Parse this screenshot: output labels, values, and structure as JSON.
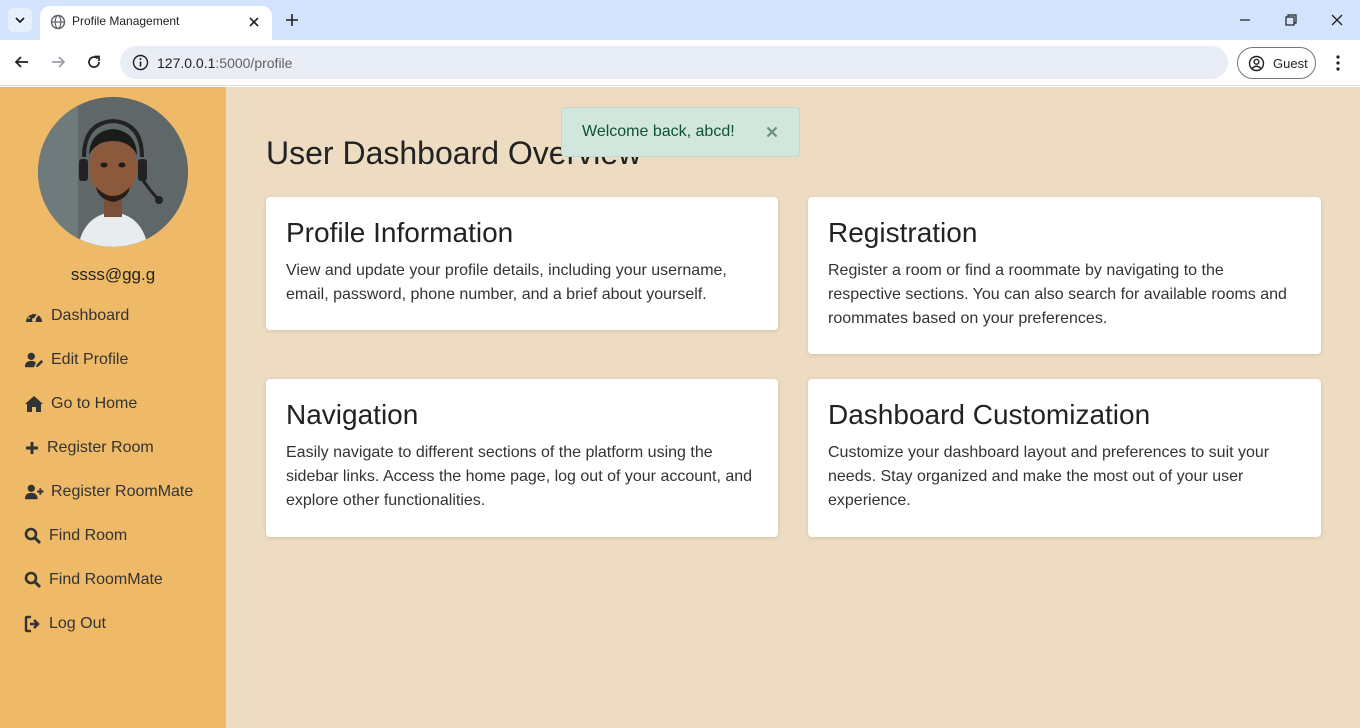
{
  "browser": {
    "tab_title": "Profile Management",
    "url_host": "127.0.0.1",
    "url_rest": ":5000/profile",
    "profile_label": "Guest"
  },
  "sidebar": {
    "email": "ssss@gg.g",
    "items": [
      {
        "label": "Dashboard",
        "icon": "tachometer-icon"
      },
      {
        "label": "Edit Profile",
        "icon": "user-edit-icon"
      },
      {
        "label": "Go to Home",
        "icon": "home-icon"
      },
      {
        "label": "Register Room",
        "icon": "plus-icon"
      },
      {
        "label": "Register RoomMate",
        "icon": "user-plus-icon"
      },
      {
        "label": "Find Room",
        "icon": "search-icon"
      },
      {
        "label": "Find RoomMate",
        "icon": "search-icon"
      },
      {
        "label": "Log Out",
        "icon": "sign-out-icon"
      }
    ]
  },
  "main": {
    "title": "User Dashboard Overview",
    "toast": {
      "message": "Welcome back, abcd!"
    },
    "cards": [
      {
        "title": "Profile Information",
        "text": "View and update your profile details, including your username, email, password, phone number, and a brief about yourself."
      },
      {
        "title": "Registration",
        "text": "Register a room or find a roommate by navigating to the respective sections. You can also search for available rooms and roommates based on your preferences."
      },
      {
        "title": "Navigation",
        "text": "Easily navigate to different sections of the platform using the sidebar links. Access the home page, log out of your account, and explore other functionalities."
      },
      {
        "title": "Dashboard Customization",
        "text": "Customize your dashboard layout and preferences to suit your needs. Stay organized and make the most out of your user experience."
      }
    ]
  },
  "colors": {
    "sidebar_bg": "#eeba68",
    "main_bg": "#eddcc1",
    "toast_bg": "#d1e7dd",
    "toast_text": "#0f5132"
  }
}
